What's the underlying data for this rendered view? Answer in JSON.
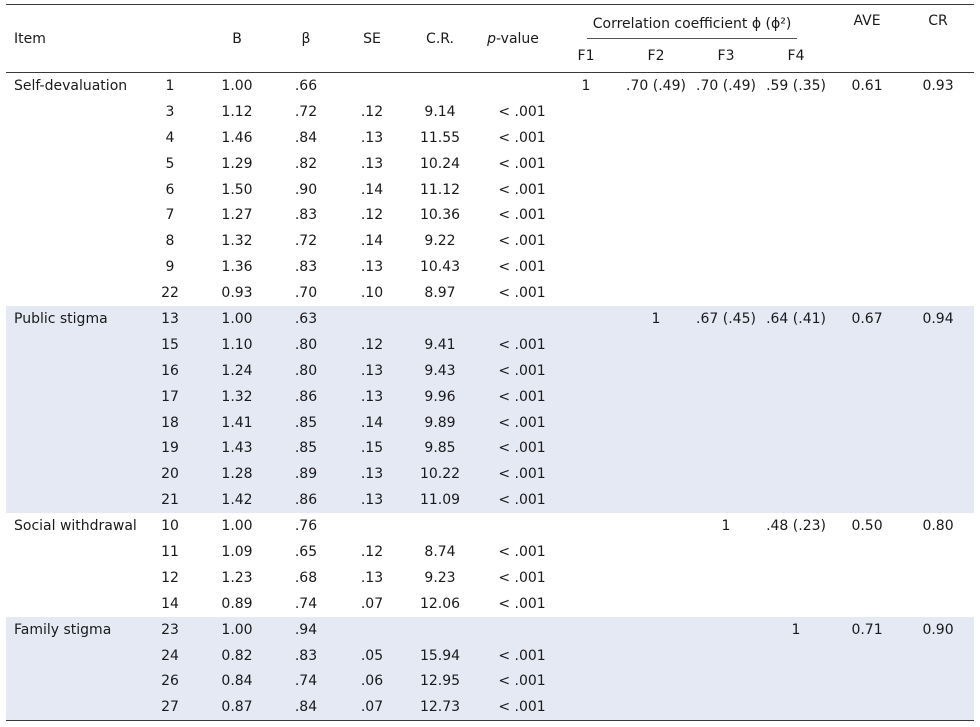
{
  "table": {
    "headers": {
      "item": "Item",
      "b": "B",
      "beta": "β",
      "se": "SE",
      "cr_stat": "C.R.",
      "p_italic": "p",
      "p_rest": "-value",
      "corr_group": "Correlation coefficient ϕ (ϕ²)",
      "f1": "F1",
      "f2": "F2",
      "f3": "F3",
      "f4": "F4",
      "ave": "AVE",
      "cr": "CR"
    },
    "groups": [
      {
        "name": "Self-devaluation",
        "rows": [
          {
            "no": "1",
            "b": "1.00",
            "beta": ".66",
            "se": "",
            "crv": "",
            "p": "",
            "f1": "1",
            "f2": ".70 (.49)",
            "f3": ".70 (.49)",
            "f4": ".59 (.35)",
            "ave": "0.61",
            "cr": "0.93"
          },
          {
            "no": "3",
            "b": "1.12",
            "beta": ".72",
            "se": ".12",
            "crv": "9.14",
            "p": "< .001"
          },
          {
            "no": "4",
            "b": "1.46",
            "beta": ".84",
            "se": ".13",
            "crv": "11.55",
            "p": "< .001"
          },
          {
            "no": "5",
            "b": "1.29",
            "beta": ".82",
            "se": ".13",
            "crv": "10.24",
            "p": "< .001"
          },
          {
            "no": "6",
            "b": "1.50",
            "beta": ".90",
            "se": ".14",
            "crv": "11.12",
            "p": "< .001"
          },
          {
            "no": "7",
            "b": "1.27",
            "beta": ".83",
            "se": ".12",
            "crv": "10.36",
            "p": "< .001"
          },
          {
            "no": "8",
            "b": "1.32",
            "beta": ".72",
            "se": ".14",
            "crv": "9.22",
            "p": "< .001"
          },
          {
            "no": "9",
            "b": "1.36",
            "beta": ".83",
            "se": ".13",
            "crv": "10.43",
            "p": "< .001"
          },
          {
            "no": "22",
            "b": "0.93",
            "beta": ".70",
            "se": ".10",
            "crv": "8.97",
            "p": "< .001"
          }
        ]
      },
      {
        "name": "Public stigma",
        "rows": [
          {
            "no": "13",
            "b": "1.00",
            "beta": ".63",
            "se": "",
            "crv": "",
            "p": "",
            "f2": "1",
            "f3": ".67 (.45)",
            "f4": ".64 (.41)",
            "ave": "0.67",
            "cr": "0.94"
          },
          {
            "no": "15",
            "b": "1.10",
            "beta": ".80",
            "se": ".12",
            "crv": "9.41",
            "p": "< .001"
          },
          {
            "no": "16",
            "b": "1.24",
            "beta": ".80",
            "se": ".13",
            "crv": "9.43",
            "p": "< .001"
          },
          {
            "no": "17",
            "b": "1.32",
            "beta": ".86",
            "se": ".13",
            "crv": "9.96",
            "p": "< .001"
          },
          {
            "no": "18",
            "b": "1.41",
            "beta": ".85",
            "se": ".14",
            "crv": "9.89",
            "p": "< .001"
          },
          {
            "no": "19",
            "b": "1.43",
            "beta": ".85",
            "se": ".15",
            "crv": "9.85",
            "p": "< .001"
          },
          {
            "no": "20",
            "b": "1.28",
            "beta": ".89",
            "se": ".13",
            "crv": "10.22",
            "p": "< .001"
          },
          {
            "no": "21",
            "b": "1.42",
            "beta": ".86",
            "se": ".13",
            "crv": "11.09",
            "p": "< .001"
          }
        ]
      },
      {
        "name": "Social withdrawal",
        "rows": [
          {
            "no": "10",
            "b": "1.00",
            "beta": ".76",
            "se": "",
            "crv": "",
            "p": "",
            "f3": "1",
            "f4": ".48 (.23)",
            "ave": "0.50",
            "cr": "0.80"
          },
          {
            "no": "11",
            "b": "1.09",
            "beta": ".65",
            "se": ".12",
            "crv": "8.74",
            "p": "< .001"
          },
          {
            "no": "12",
            "b": "1.23",
            "beta": ".68",
            "se": ".13",
            "crv": "9.23",
            "p": "< .001"
          },
          {
            "no": "14",
            "b": "0.89",
            "beta": ".74",
            "se": ".07",
            "crv": "12.06",
            "p": "< .001"
          }
        ]
      },
      {
        "name": "Family stigma",
        "rows": [
          {
            "no": "23",
            "b": "1.00",
            "beta": ".94",
            "se": "",
            "crv": "",
            "p": "",
            "f4": "1",
            "ave": "0.71",
            "cr": "0.90"
          },
          {
            "no": "24",
            "b": "0.82",
            "beta": ".83",
            "se": ".05",
            "crv": "15.94",
            "p": "< .001"
          },
          {
            "no": "26",
            "b": "0.84",
            "beta": ".74",
            "se": ".06",
            "crv": "12.95",
            "p": "< .001"
          },
          {
            "no": "27",
            "b": "0.87",
            "beta": ".84",
            "se": ".07",
            "crv": "12.73",
            "p": "< .001"
          }
        ]
      }
    ]
  }
}
